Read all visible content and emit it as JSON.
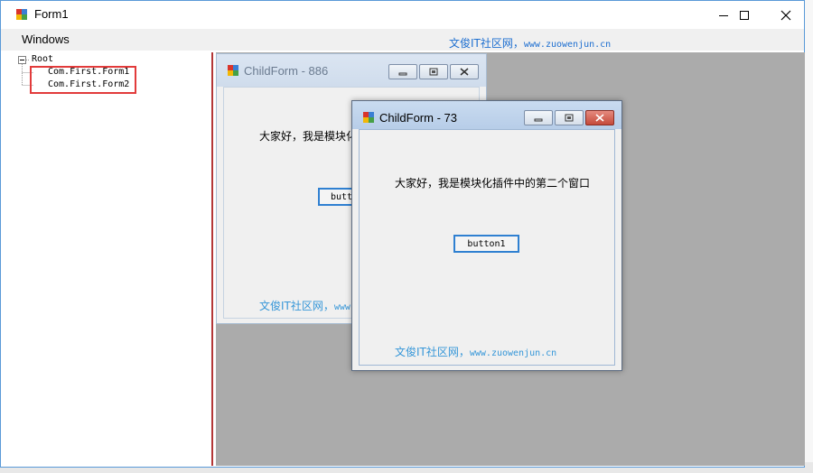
{
  "window": {
    "title": "Form1"
  },
  "menu": {
    "windows_label": "Windows",
    "link_cn": "文俊IT社区网，",
    "link_url": "www.zuowenjun.cn"
  },
  "tree": {
    "root_label": "Root",
    "children": [
      "Com.First.Form1",
      "Com.First.Form2"
    ]
  },
  "child_form_back": {
    "title": "ChildForm - 886",
    "greeting": "大家好，我是模块化",
    "button_label": "butt",
    "link_cn": "文俊IT社区网，",
    "link_url": "www"
  },
  "child_form_front": {
    "title": "ChildForm - 73",
    "greeting": "大家好，我是模块化插件中的第二个窗口",
    "button_label": "button1",
    "link_cn": "文俊IT社区网，",
    "link_url": "www.zuowenjun.cn"
  },
  "colors": {
    "accent": "#2f80d1",
    "link": "#3596d8",
    "highlight_box": "#e23b3b",
    "mdi_background": "#ababab"
  }
}
